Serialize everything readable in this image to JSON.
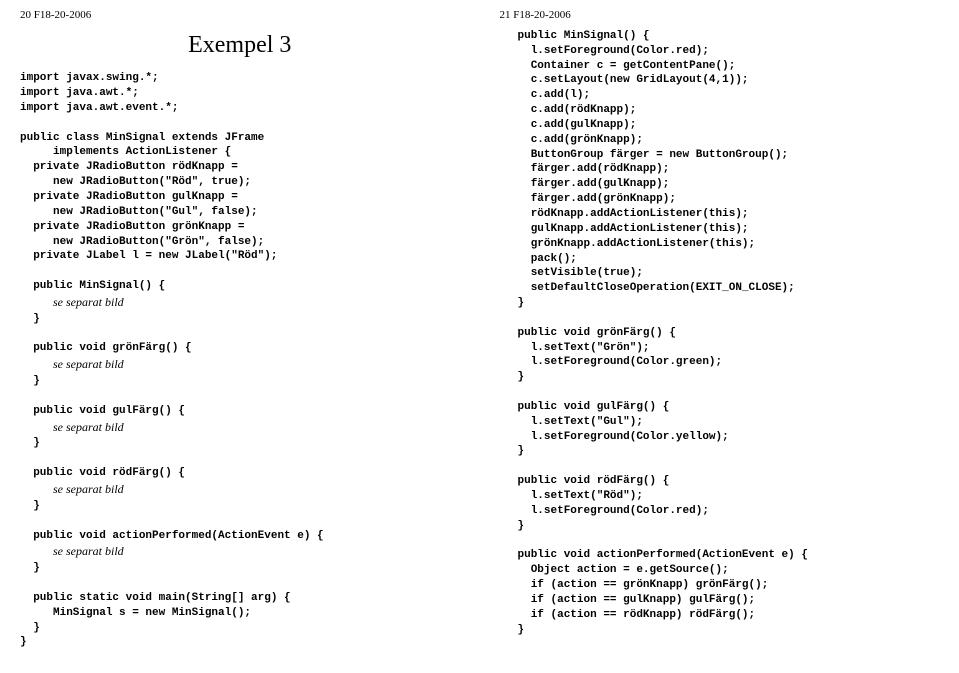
{
  "left": {
    "header": "20 F18-20-2006",
    "title": "Exempel 3",
    "code1": "import javax.swing.*;\nimport java.awt.*;\nimport java.awt.event.*;\n\npublic class MinSignal extends JFrame\n     implements ActionListener {\n  private JRadioButton rödKnapp =\n     new JRadioButton(\"Röd\", true);\n  private JRadioButton gulKnapp =\n     new JRadioButton(\"Gul\", false);\n  private JRadioButton grönKnapp =\n     new JRadioButton(\"Grön\", false);\n  private JLabel l = new JLabel(\"Röd\");\n\n  public MinSignal() {",
    "italic1": "se separat bild",
    "code2": "  }\n\n  public void grönFärg() {",
    "italic2": "se separat bild",
    "code3": "  }\n\n  public void gulFärg() {",
    "italic3": "se separat bild",
    "code4": "  }\n\n  public void rödFärg() {",
    "italic4": "se separat bild",
    "code5": "  }\n\n  public void actionPerformed(ActionEvent e) {",
    "italic5": "se separat bild",
    "code6": "  }\n\n  public static void main(String[] arg) {\n     MinSignal s = new MinSignal();\n  }\n}"
  },
  "right": {
    "header": "21 F18-20-2006",
    "code": "public MinSignal() {\n  l.setForeground(Color.red);\n  Container c = getContentPane();\n  c.setLayout(new GridLayout(4,1));\n  c.add(l);\n  c.add(rödKnapp);\n  c.add(gulKnapp);\n  c.add(grönKnapp);\n  ButtonGroup färger = new ButtonGroup();\n  färger.add(rödKnapp);\n  färger.add(gulKnapp);\n  färger.add(grönKnapp);\n  rödKnapp.addActionListener(this);\n  gulKnapp.addActionListener(this);\n  grönKnapp.addActionListener(this);\n  pack();\n  setVisible(true);\n  setDefaultCloseOperation(EXIT_ON_CLOSE);\n}\n\npublic void grönFärg() {\n  l.setText(\"Grön\");\n  l.setForeground(Color.green);\n}\n\npublic void gulFärg() {\n  l.setText(\"Gul\");\n  l.setForeground(Color.yellow);\n}\n\npublic void rödFärg() {\n  l.setText(\"Röd\");\n  l.setForeground(Color.red);\n}\n\npublic void actionPerformed(ActionEvent e) {\n  Object action = e.getSource();\n  if (action == grönKnapp) grönFärg();\n  if (action == gulKnapp) gulFärg();\n  if (action == rödKnapp) rödFärg();\n}"
  }
}
